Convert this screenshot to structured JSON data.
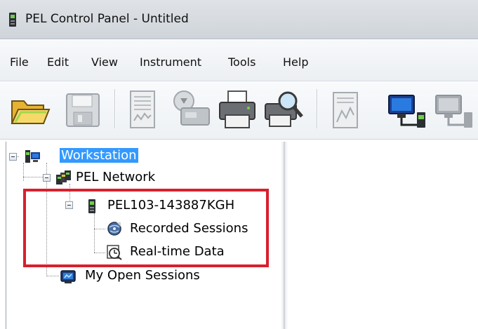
{
  "window": {
    "title": "PEL Control Panel - Untitled"
  },
  "menu": {
    "items": [
      "File",
      "Edit",
      "View",
      "Instrument",
      "Tools",
      "Help"
    ]
  },
  "toolbar": {
    "buttons": [
      {
        "icon": "open-folder-icon",
        "enabled": true
      },
      {
        "icon": "save-disk-icon",
        "enabled": false
      },
      {
        "icon": "report-icon",
        "enabled": false
      },
      {
        "icon": "download-icon",
        "enabled": false
      },
      {
        "icon": "print-icon",
        "enabled": true
      },
      {
        "icon": "print-preview-icon",
        "enabled": true
      },
      {
        "icon": "document-icon",
        "enabled": false
      },
      {
        "icon": "connect-instrument-icon",
        "enabled": true
      },
      {
        "icon": "network-instrument-icon",
        "enabled": false
      }
    ]
  },
  "tree": {
    "workstation": "Workstation",
    "pel_network": "PEL Network",
    "instrument": "PEL103-143887KGH",
    "recorded_sessions": "Recorded Sessions",
    "realtime_data": "Real-time Data",
    "my_open_sessions": "My Open Sessions"
  },
  "colors": {
    "selection": "#3399ff",
    "highlight_box": "#d8202e"
  }
}
